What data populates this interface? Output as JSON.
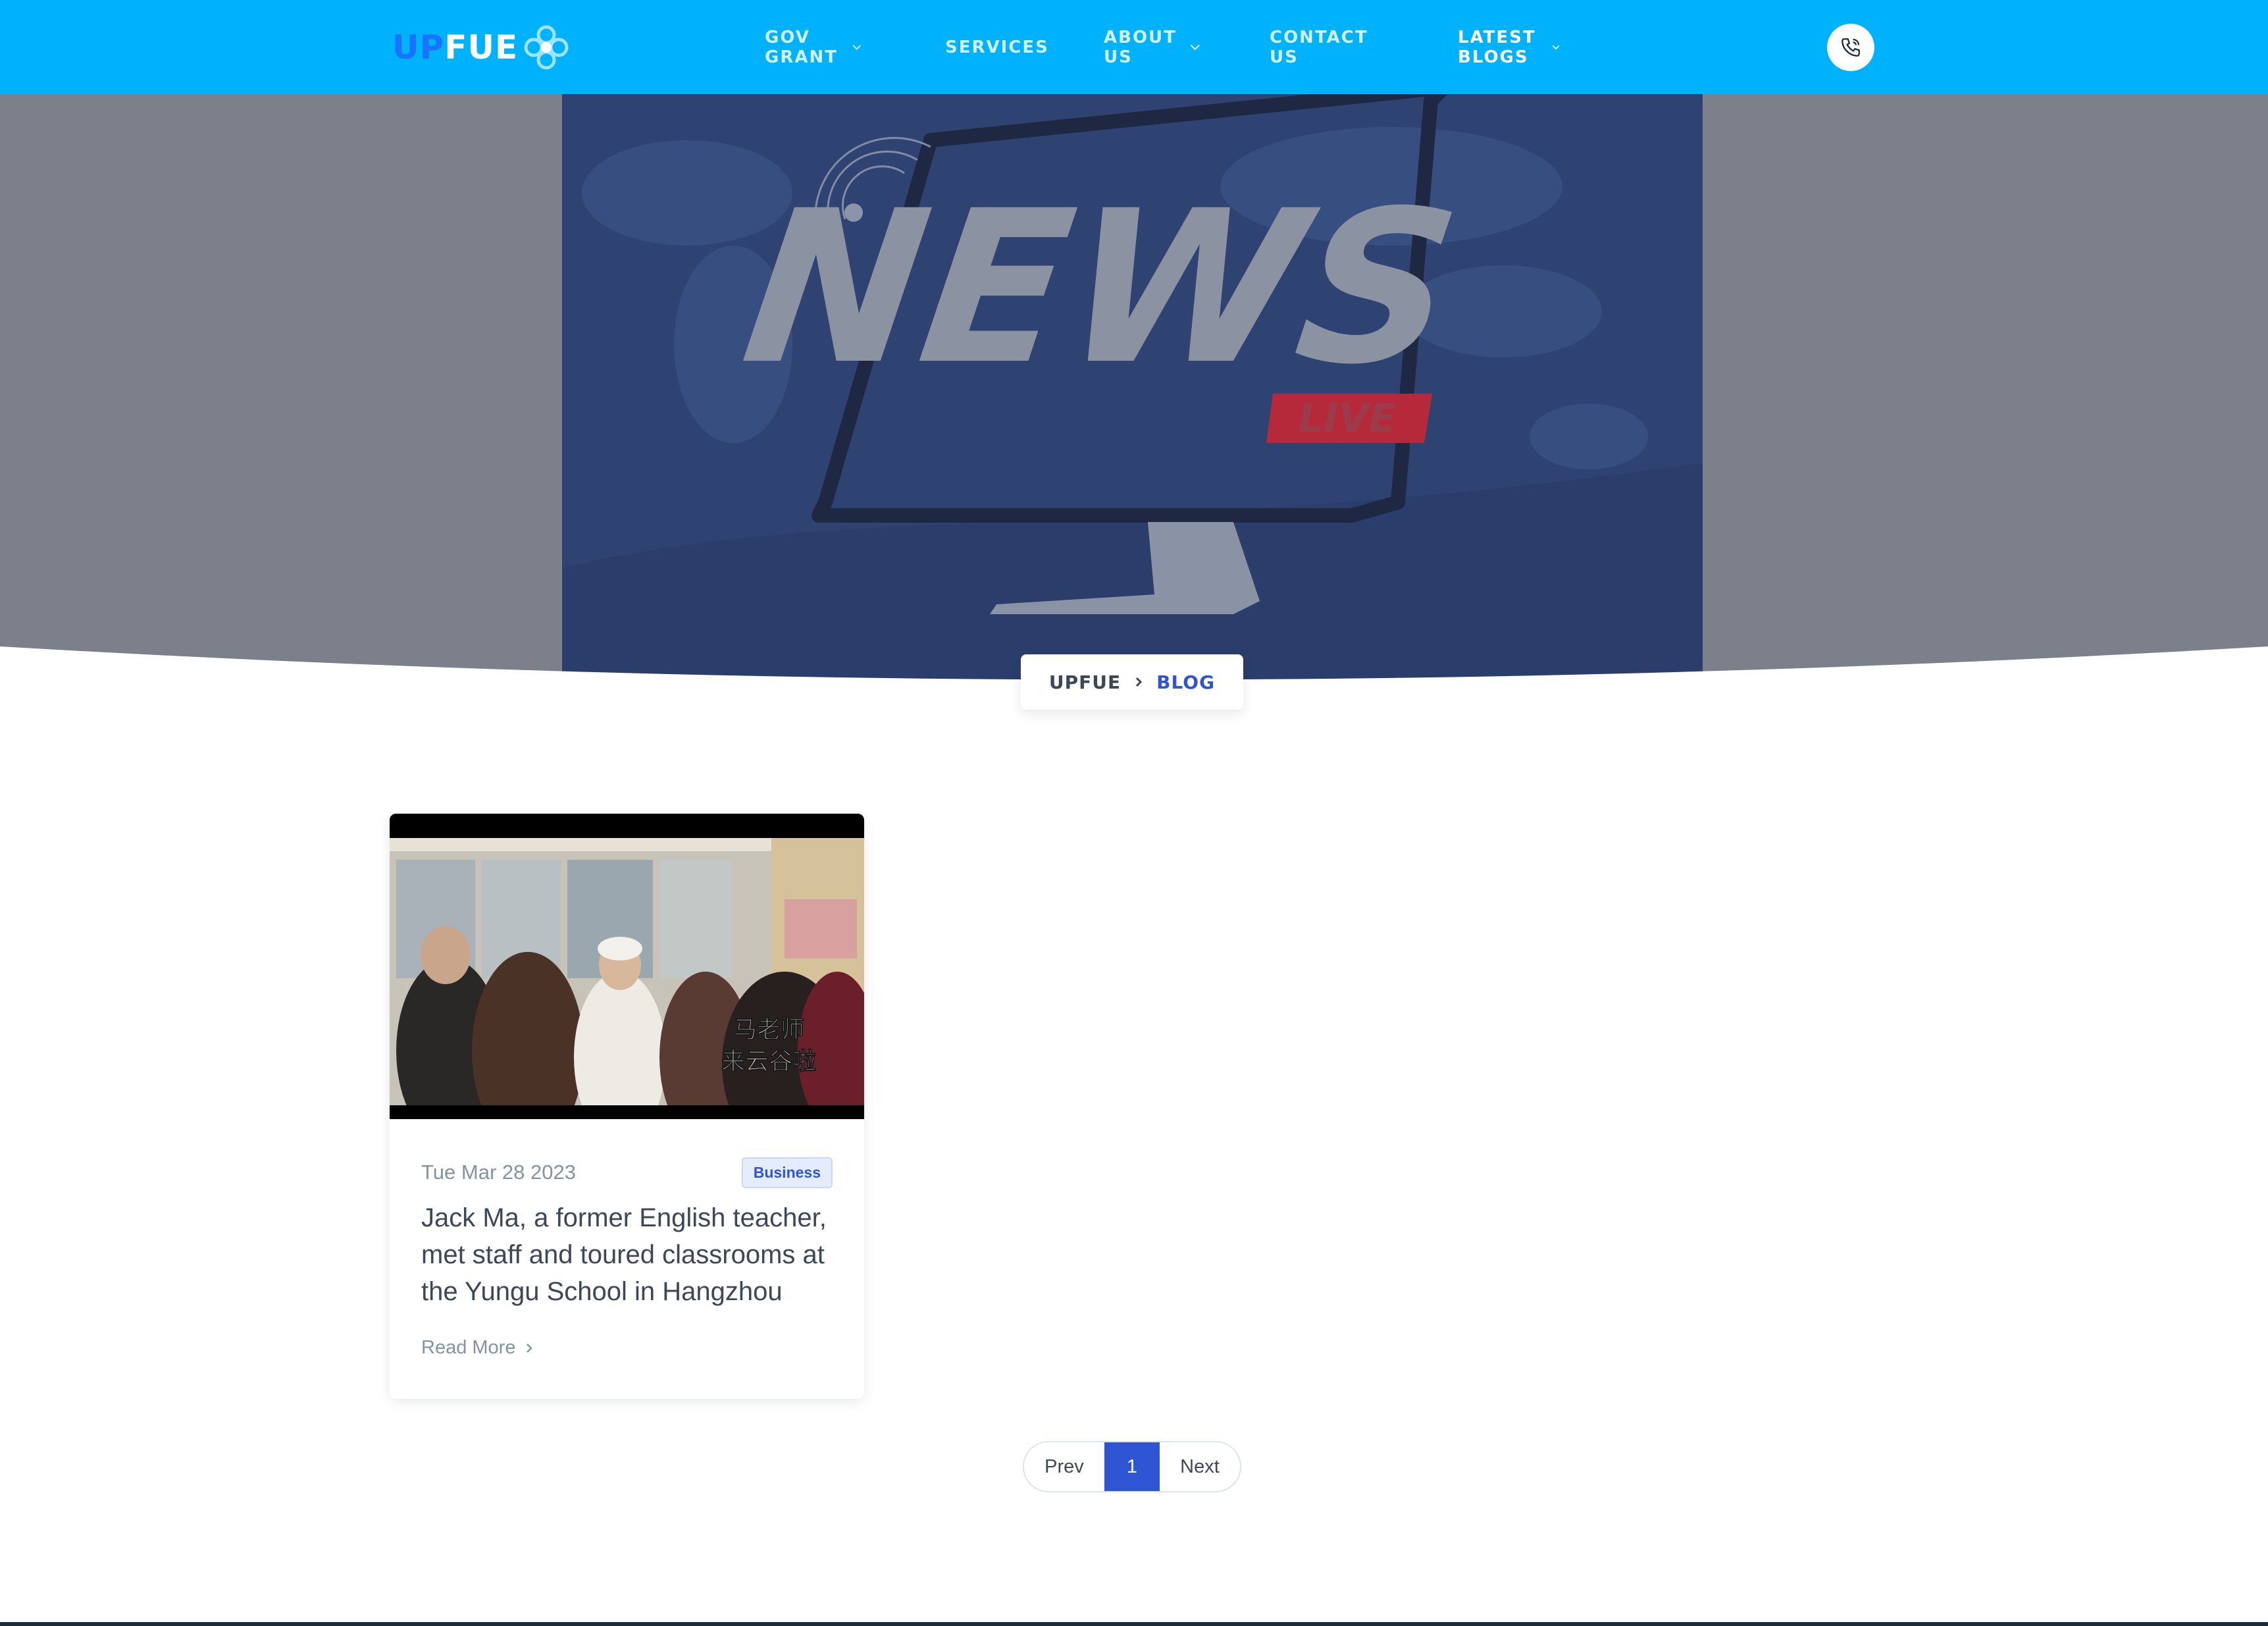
{
  "brand": {
    "part1": "UP",
    "part2": "FUE"
  },
  "nav": {
    "items": [
      {
        "label": "GOV GRANT"
      },
      {
        "label": "SERVICES"
      },
      {
        "label": "ABOUT US"
      },
      {
        "label": "CONTACT US"
      },
      {
        "label": "LATEST BLOGS"
      }
    ]
  },
  "hero": {
    "headline": "NEWS",
    "tag": "LIVE"
  },
  "breadcrumb": {
    "home": "UPFUE",
    "current": "BLOG"
  },
  "posts": [
    {
      "date": "Tue Mar 28 2023",
      "category": "Business",
      "title": "Jack Ma, a former English teacher, met staff and toured classrooms at the Yungu School in Hangzhou",
      "read_more": "Read More",
      "image_caption_line1": "马老师",
      "image_caption_line2": "来云谷啦"
    }
  ],
  "pagination": {
    "prev": "Prev",
    "current": "1",
    "next": "Next"
  },
  "colors": {
    "navbar": "#00b2fc",
    "primary": "#2f55d4",
    "hero_bg": "#7b808b",
    "hero_image_bg": "#2f4373"
  }
}
